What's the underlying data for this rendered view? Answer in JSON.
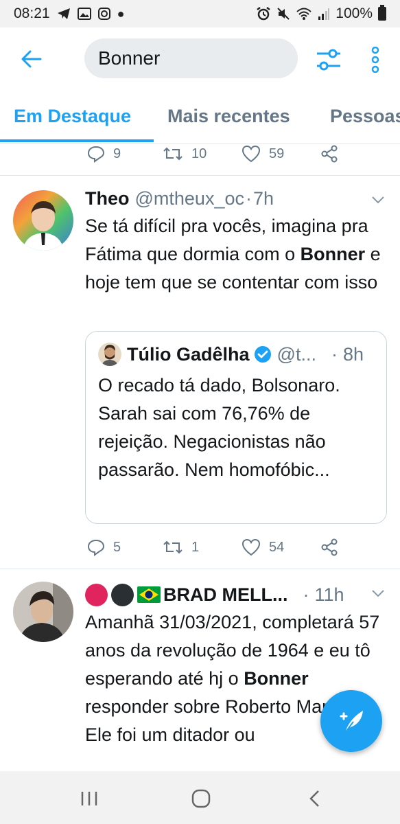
{
  "status_bar": {
    "time": "08:21",
    "battery": "100%",
    "left_icons": [
      "telegram-icon",
      "image-icon",
      "instagram-icon",
      "dot-icon"
    ],
    "right_icons": [
      "alarm-icon",
      "mute-icon",
      "wifi-icon",
      "signal-icon",
      "battery-icon"
    ]
  },
  "search": {
    "query": "Bonner"
  },
  "tabs": [
    {
      "label": "Em Destaque",
      "active": true
    },
    {
      "label": "Mais recentes",
      "active": false
    },
    {
      "label": "Pessoas",
      "active": false
    }
  ],
  "previous_tweet_actions": {
    "replies": "9",
    "retweets": "10",
    "likes": "59"
  },
  "tweets": [
    {
      "name": "Theo",
      "handle": "@mtheux_oc",
      "separator": "·",
      "time": "7h",
      "text_parts": [
        "Se tá difícil pra vocês, imagina pra Fátima que dormia com o ",
        "Bonner",
        " e hoje tem que se contentar com isso"
      ],
      "quote": {
        "name": "Túlio Gadêlha",
        "handle": "@t...",
        "separator": "·",
        "time": "8h",
        "text": "O recado tá dado, Bolsonaro. Sarah sai com 76,76% de rejeição. Negacionistas não passarão. Nem homofóbic..."
      },
      "actions": {
        "replies": "5",
        "retweets": "1",
        "likes": "54"
      }
    },
    {
      "name": "BRAD MELL...",
      "separator": "·",
      "time": "11h",
      "text_parts": [
        "Amanhã 31/03/2021, completará 57 anos da revolução de 1964 e eu tô esperando até hj o ",
        "Bonner",
        " responder sobre Roberto Marinho: Ele foi um ditador ou"
      ]
    }
  ],
  "colors": {
    "accent": "#1da1f2",
    "text": "#14171a",
    "secondary": "#657786"
  }
}
